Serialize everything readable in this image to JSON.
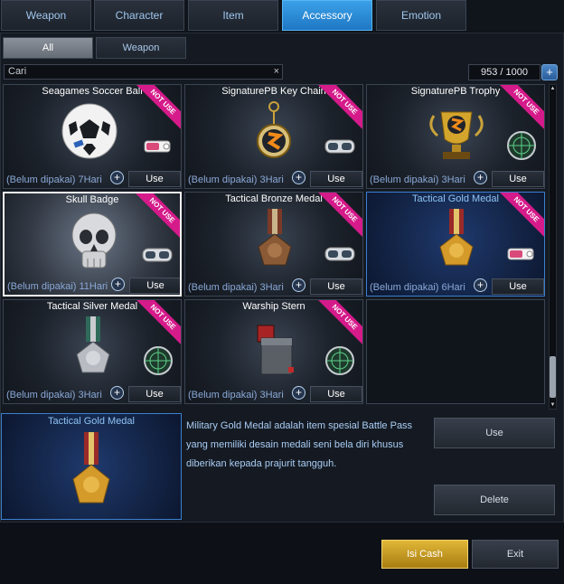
{
  "tabs": [
    {
      "label": "Weapon",
      "active": false
    },
    {
      "label": "Character",
      "active": false
    },
    {
      "label": "Item",
      "active": false
    },
    {
      "label": "Accessory",
      "active": true
    },
    {
      "label": "Emotion",
      "active": false
    }
  ],
  "subtabs": [
    {
      "label": "All",
      "active": true
    },
    {
      "label": "Weapon",
      "active": false
    }
  ],
  "search": {
    "value": "Cari",
    "clear": "×"
  },
  "counter": {
    "value": "953 / 1000",
    "button": "+"
  },
  "card_common": {
    "plus": "+",
    "use_label": "Use",
    "not_use_label": "NOT USE"
  },
  "cards": [
    {
      "title": "Seagames Soccer Ball",
      "duration": "(Belum dipakai) 7Hari",
      "icon": "soccer-ball-icon",
      "badge": "pink-tag-icon"
    },
    {
      "title": "SignaturePB Key Chain",
      "duration": "(Belum dipakai) 3Hari",
      "icon": "keychain-icon",
      "badge": "goggles-icon"
    },
    {
      "title": "SignaturePB Trophy",
      "duration": "(Belum dipakai) 3Hari",
      "icon": "trophy-icon",
      "badge": "radar-icon"
    },
    {
      "title": "Skull Badge",
      "duration": "(Belum dipakai) 11Hari",
      "icon": "skull-icon",
      "badge": "goggles-icon"
    },
    {
      "title": "Tactical Bronze Medal",
      "duration": "(Belum dipakai) 3Hari",
      "icon": "bronze-medal-icon",
      "badge": "goggles-icon"
    },
    {
      "title": "Tactical Gold Medal",
      "duration": "(Belum dipakai) 6Hari",
      "icon": "gold-medal-icon",
      "badge": "pink-tag-icon"
    },
    {
      "title": "Tactical Silver Medal",
      "duration": "(Belum dipakai) 3Hari",
      "icon": "silver-medal-icon",
      "badge": "radar-icon"
    },
    {
      "title": "Warship Stern",
      "duration": "(Belum dipakai) 3Hari",
      "icon": "warship-stern-icon",
      "badge": "radar-icon"
    }
  ],
  "detail": {
    "title": "Tactical Gold Medal",
    "description": [
      "Military Gold Medal adalah item spesial Battle Pass",
      " yang memiliki desain medali seni bela diri khusus",
      "diberikan kepada prajurit tangguh."
    ],
    "use_label": "Use",
    "delete_label": "Delete"
  },
  "footer": {
    "cash_label": "Isi Cash",
    "exit_label": "Exit"
  },
  "colors": {
    "accent_blue": "#2b8fdc",
    "not_use_pink": "#d51a8a",
    "cash_gold": "#c99a22"
  }
}
